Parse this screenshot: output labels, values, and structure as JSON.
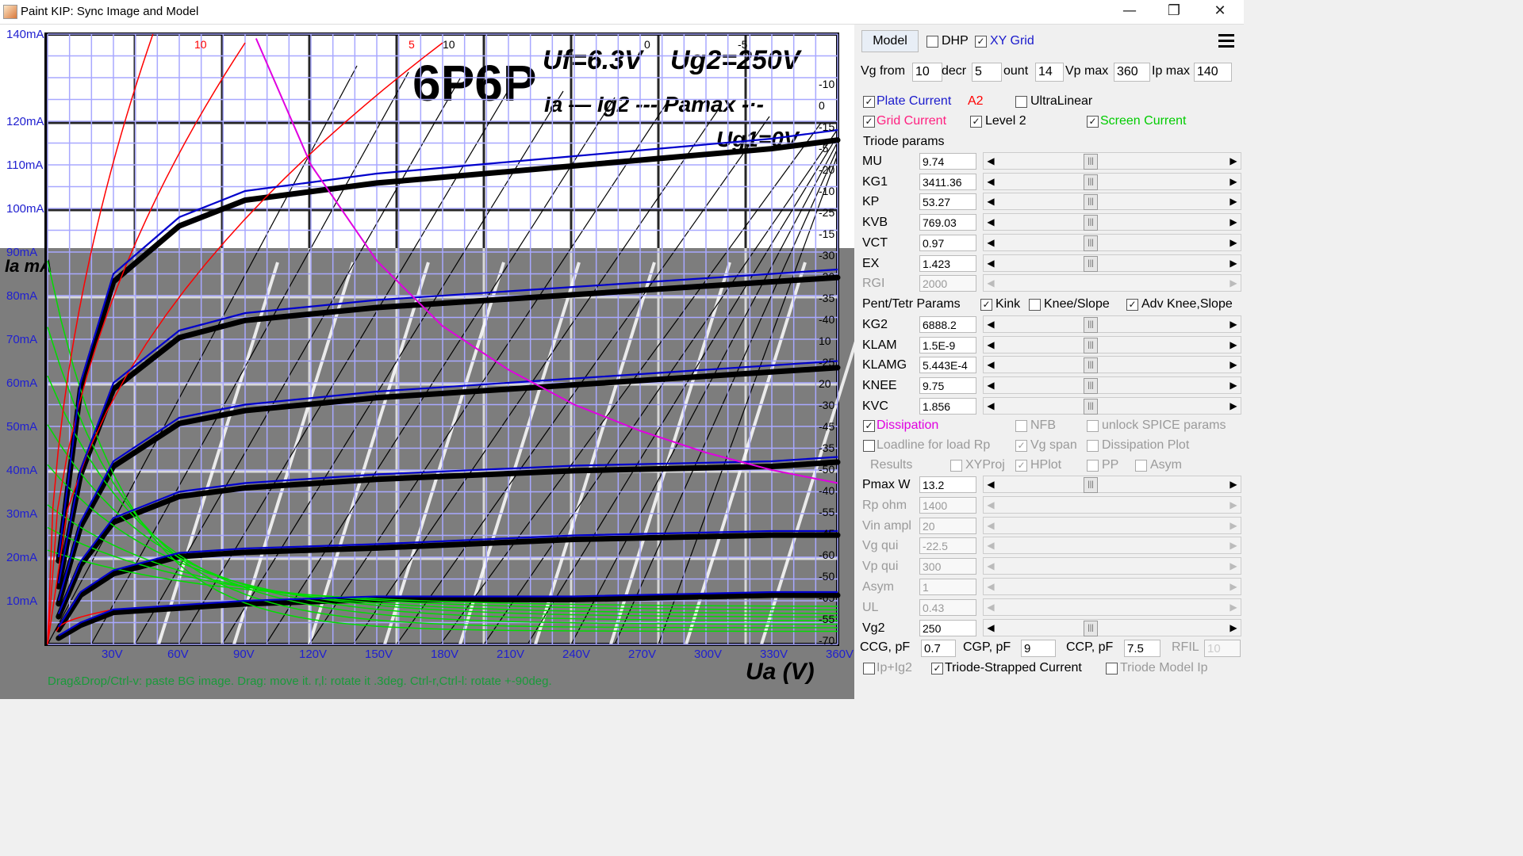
{
  "window": {
    "title": "Paint KIP: Sync Image and Model",
    "min_glyph": "—",
    "max_glyph": "❐",
    "close_glyph": "✕"
  },
  "plot": {
    "y_ticks": [
      "140mA",
      "120mA",
      "110mA",
      "100mA",
      "90mA",
      "80mA",
      "70mA",
      "60mA",
      "50mA",
      "40mA",
      "30mA",
      "20mA",
      "10mA"
    ],
    "x_ticks": [
      "30V",
      "60V",
      "90V",
      "120V",
      "150V",
      "180V",
      "210V",
      "240V",
      "270V",
      "300V",
      "330V",
      "360V"
    ],
    "hint": "Drag&Drop/Ctrl-v: paste BG image. Drag: move it. r,l: rotate it .3deg. Ctrl-r,Ctrl-l: rotate +-90deg.",
    "grid_labels_right": [
      "-10",
      "0",
      "-15",
      "-5",
      "-20",
      "-10",
      "-25",
      "-15",
      "-30",
      "-20",
      "-35",
      "-40",
      "10",
      "-25",
      "20",
      "-30",
      "-45",
      "-35",
      "-50",
      "-40",
      "-55",
      "-45",
      "-60",
      "-50",
      "-65",
      "-55",
      "-70"
    ],
    "grid_labels_top": [
      "10",
      "5",
      "10",
      "0",
      "-5"
    ],
    "image_text": {
      "tube": "6P6P",
      "uf": "Uf=6.3V",
      "ug2": "Ug2=250V",
      "legend": "Ia — Ig2 --- Pamax -·-",
      "ug1": "Ug1=0V",
      "axis_x": "Ua (V)",
      "axis_y": "Ia mA"
    },
    "colors": {
      "plate": "#0000cc",
      "grid": "#ff0000",
      "screen": "#00cc00",
      "dissipation": "#e000e0",
      "gridline": "#a0a0ff"
    }
  },
  "chart_data": {
    "type": "line",
    "title": "",
    "xlabel": "",
    "ylabel": "",
    "xlim": [
      0,
      360
    ],
    "ylim": [
      0,
      140
    ],
    "x_ticks": [
      30,
      60,
      90,
      120,
      150,
      180,
      210,
      240,
      270,
      300,
      330,
      360
    ],
    "y_ticks": [
      10,
      20,
      30,
      40,
      50,
      60,
      70,
      80,
      90,
      100,
      110,
      120,
      140
    ],
    "series": [
      {
        "name": "Plate Current",
        "x": [
          5,
          15,
          30,
          60,
          90,
          150,
          240,
          330,
          360
        ],
        "y": [
          20,
          60,
          85,
          98,
          104,
          108,
          112,
          116,
          118
        ]
      },
      {
        "name": "Plate Current",
        "x": [
          5,
          15,
          30,
          60,
          90,
          150,
          240,
          330,
          360
        ],
        "y": [
          14,
          40,
          60,
          72,
          76,
          79,
          82,
          85,
          86
        ]
      },
      {
        "name": "Plate Current",
        "x": [
          5,
          15,
          30,
          60,
          90,
          150,
          240,
          330,
          360
        ],
        "y": [
          10,
          28,
          42,
          52,
          55,
          58,
          61,
          64,
          65
        ]
      },
      {
        "name": "Plate Current",
        "x": [
          5,
          15,
          30,
          60,
          90,
          150,
          240,
          330,
          360
        ],
        "y": [
          7,
          19,
          29,
          35,
          37,
          39,
          41,
          42,
          43
        ]
      },
      {
        "name": "Plate Current",
        "x": [
          5,
          15,
          30,
          60,
          90,
          150,
          240,
          330,
          360
        ],
        "y": [
          4,
          12,
          17,
          21,
          22,
          23,
          25,
          26,
          26
        ]
      },
      {
        "name": "Plate Current",
        "x": [
          5,
          15,
          30,
          60,
          90,
          150,
          240,
          330,
          360
        ],
        "y": [
          2,
          5,
          8,
          9,
          10,
          11,
          11,
          12,
          12
        ]
      },
      {
        "name": "Dissipation",
        "x": [
          95,
          120,
          150,
          180,
          210,
          240,
          270,
          300,
          330,
          360
        ],
        "y": [
          139,
          110,
          88,
          73,
          63,
          55,
          49,
          44,
          40,
          37
        ]
      }
    ]
  },
  "panel": {
    "model_btn": "Model",
    "dhp": {
      "label": "DHP",
      "checked": false
    },
    "xygrid": {
      "label": "XY Grid",
      "checked": true
    },
    "vg_from_label": "Vg from",
    "vg_from": "10",
    "decr_label": "decr",
    "decr": "5",
    "count_label": "ount",
    "count": "14",
    "vpmax_label": "Vp max",
    "vpmax": "360",
    "ipmax_label": "Ip max",
    "ipmax": "140",
    "plate_current": "Plate Current",
    "a2": "A2",
    "ultralinear": "UltraLinear",
    "grid_current": "Grid Current",
    "level2": "Level 2",
    "screen_current": "Screen Current",
    "triode_params": "Triode params",
    "triode_rows": [
      {
        "label": "MU",
        "value": "9.74"
      },
      {
        "label": "KG1",
        "value": "3411.36"
      },
      {
        "label": "KP",
        "value": "53.27"
      },
      {
        "label": "KVB",
        "value": "769.03"
      },
      {
        "label": "VCT",
        "value": "0.97"
      },
      {
        "label": "EX",
        "value": "1.423"
      },
      {
        "label": "RGI",
        "value": "2000"
      }
    ],
    "pent_params": "Pent/Tetr Params",
    "kink": "Kink",
    "knee_slope": "Knee/Slope",
    "adv_knee": "Adv Knee,Slope",
    "pent_rows": [
      {
        "label": "KG2",
        "value": "6888.2"
      },
      {
        "label": "KLAM",
        "value": "1.5E-9"
      },
      {
        "label": "KLAMG",
        "value": "5.443E-4"
      },
      {
        "label": "KNEE",
        "value": "9.75"
      },
      {
        "label": "KVC",
        "value": "1.856"
      }
    ],
    "dissipation": "Dissipation",
    "nfb": "NFB",
    "unlock": "unlock SPICE params",
    "loadline": "Loadline for load Rp",
    "vgspan": "Vg span",
    "dissplot": "Dissipation Plot",
    "results": "Results",
    "xyproj": "XYProj",
    "hplot": "HPlot",
    "pp": "PP",
    "asym": "Asym",
    "load_rows": [
      {
        "label": "Pmax W",
        "value": "13.2"
      },
      {
        "label": "Rp ohm",
        "value": "1400"
      },
      {
        "label": "Vin ampl",
        "value": "20"
      },
      {
        "label": "Vg qui",
        "value": "-22.5"
      },
      {
        "label": "Vp qui",
        "value": "300"
      },
      {
        "label": "Asym",
        "value": "1"
      },
      {
        "label": "UL",
        "value": "0.43"
      },
      {
        "label": "Vg2",
        "value": "250"
      }
    ],
    "ccg_label": "CCG, pF",
    "ccg": "0.7",
    "cgp_label": "CGP, pF",
    "cgp": "9",
    "ccp_label": "CCP, pF",
    "ccp": "7.5",
    "rfil_label": "RFIL",
    "rfil": "10",
    "ipig2": "Ip+Ig2",
    "triode_strapped": "Triode-Strapped Current",
    "triode_model": "Triode Model Ip"
  }
}
